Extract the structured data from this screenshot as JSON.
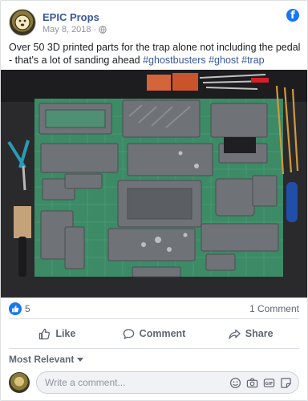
{
  "post": {
    "page_name": "EPIC Props",
    "date": "May 8, 2018",
    "date_sep": "·",
    "text_main": "Over 50 3D printed parts for the trap alone not including the pedal - that's a lot of sanding ahead ",
    "hashtags": [
      "#ghostbusters",
      "#ghost",
      "#trap"
    ]
  },
  "stats": {
    "likes": "5",
    "comments": "1 Comment"
  },
  "actions": {
    "like": "Like",
    "comment": "Comment",
    "share": "Share"
  },
  "comments": {
    "sort_label": "Most Relevant",
    "placeholder": "Write a comment..."
  },
  "colors": {
    "link": "#385898",
    "facebook_blue": "#1877f2",
    "cutting_mat": "#3c8a66",
    "printed_parts": "#6f7277"
  },
  "icons": {
    "facebook": "facebook-logo-icon",
    "globe": "globe-icon",
    "like": "thumbs-up-icon",
    "comment": "speech-bubble-icon",
    "share": "share-arrow-icon",
    "sort": "caret-down-icon",
    "emoji": "smiley-icon",
    "camera": "camera-icon",
    "gif": "gif-icon",
    "sticker": "sticker-icon"
  }
}
